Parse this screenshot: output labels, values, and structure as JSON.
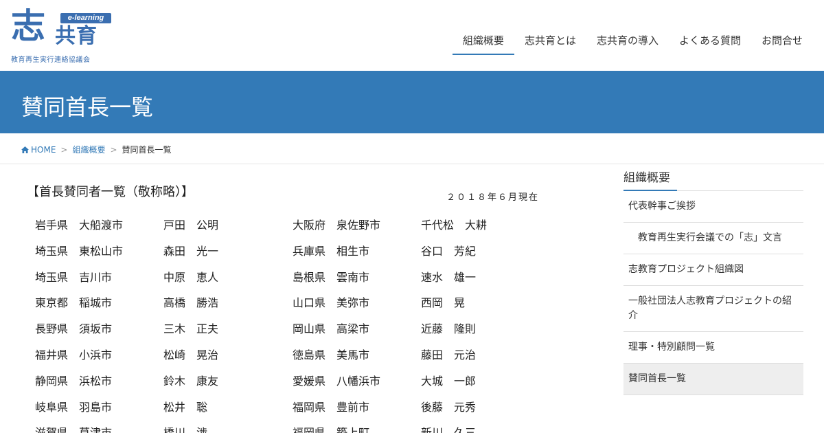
{
  "logo": {
    "main_char": "志",
    "badge": "e-learning",
    "brand": "共育",
    "subtitle": "教育再生実行連絡協議会"
  },
  "nav": {
    "items": [
      {
        "label": "組織概要",
        "active": true
      },
      {
        "label": "志共育とは",
        "active": false
      },
      {
        "label": "志共育の導入",
        "active": false
      },
      {
        "label": "よくある質問",
        "active": false
      },
      {
        "label": "お問合せ",
        "active": false
      }
    ]
  },
  "page_title": "賛同首長一覧",
  "breadcrumb": {
    "home": "HOME",
    "parent": "組織概要",
    "current": "賛同首長一覧",
    "separator": ">"
  },
  "content": {
    "heading": "【首長賛同者一覧（敬称略）】",
    "as_of": "２０１８年６月現在",
    "rows": [
      [
        "岩手県　大船渡市",
        "戸田　公明",
        "大阪府　泉佐野市",
        "千代松　大耕"
      ],
      [
        "埼玉県　東松山市",
        "森田　光一",
        "兵庫県　相生市",
        "谷口　芳紀"
      ],
      [
        "埼玉県　吉川市",
        "中原　恵人",
        "島根県　雲南市",
        "速水　雄一"
      ],
      [
        "東京都　稲城市",
        "高橋　勝浩",
        "山口県　美弥市",
        "西岡　晃"
      ],
      [
        "長野県　須坂市",
        "三木　正夫",
        "岡山県　高梁市",
        "近藤　隆則"
      ],
      [
        "福井県　小浜市",
        "松崎　晃治",
        "徳島県　美馬市",
        "藤田　元治"
      ],
      [
        "静岡県　浜松市",
        "鈴木　康友",
        "愛媛県　八幡浜市",
        "大城　一郎"
      ],
      [
        "岐阜県　羽島市",
        "松井　聡",
        "福岡県　豊前市",
        "後藤　元秀"
      ],
      [
        "滋賀県　草津市",
        "橋川　渉",
        "福岡県　築上町",
        "新川　久三"
      ]
    ]
  },
  "sidebar": {
    "title": "組織概要",
    "items": [
      {
        "label": "代表幹事ご挨拶",
        "indent": false,
        "active": false
      },
      {
        "label": "教育再生実行会議での「志」文言",
        "indent": true,
        "active": false
      },
      {
        "label": "志教育プロジェクト組織図",
        "indent": false,
        "active": false
      },
      {
        "label": "一般社団法人志教育プロジェクトの紹介",
        "indent": false,
        "active": false
      },
      {
        "label": "理事・特別顧問一覧",
        "indent": false,
        "active": false
      },
      {
        "label": "賛同首長一覧",
        "indent": false,
        "active": true
      }
    ]
  },
  "colors": {
    "accent": "#337ab7",
    "logo": "#3a6eb0"
  }
}
